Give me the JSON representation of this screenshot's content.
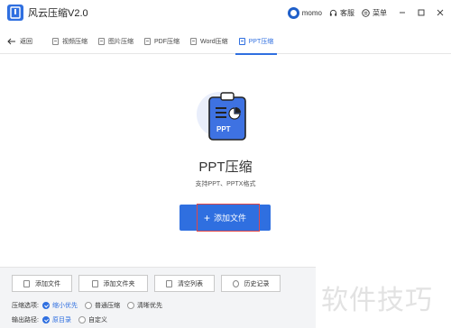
{
  "window": {
    "app_title": "风云压缩V2.0",
    "user_name": "momo",
    "service_label": "客服",
    "menu_label": "菜单"
  },
  "nav": {
    "back_label": "返回",
    "tabs": [
      {
        "label": "视频压缩",
        "active": false
      },
      {
        "label": "图片压缩",
        "active": false
      },
      {
        "label": "PDF压缩",
        "active": false
      },
      {
        "label": "Word压缩",
        "active": false
      },
      {
        "label": "PPT压缩",
        "active": true
      }
    ]
  },
  "main": {
    "icon_text": "PPT",
    "title": "PPT压缩",
    "subtitle": "支持PPT、PPTX格式",
    "add_button_label": "添加文件"
  },
  "toolbar": {
    "buttons": [
      "添加文件",
      "添加文件夹",
      "清空列表",
      "历史记录"
    ]
  },
  "options": {
    "compress_label": "压缩选项:",
    "compress_choices": [
      {
        "label": "缩小优先",
        "selected": true
      },
      {
        "label": "普通压缩",
        "selected": false
      },
      {
        "label": "清晰优先",
        "selected": false
      }
    ],
    "output_label": "输出路径:",
    "output_choices": [
      {
        "label": "原目录",
        "selected": true
      },
      {
        "label": "自定义",
        "selected": false
      }
    ]
  },
  "watermark": "软件技巧",
  "colors": {
    "accent": "#2f6fe0",
    "highlight": "#e04848"
  }
}
